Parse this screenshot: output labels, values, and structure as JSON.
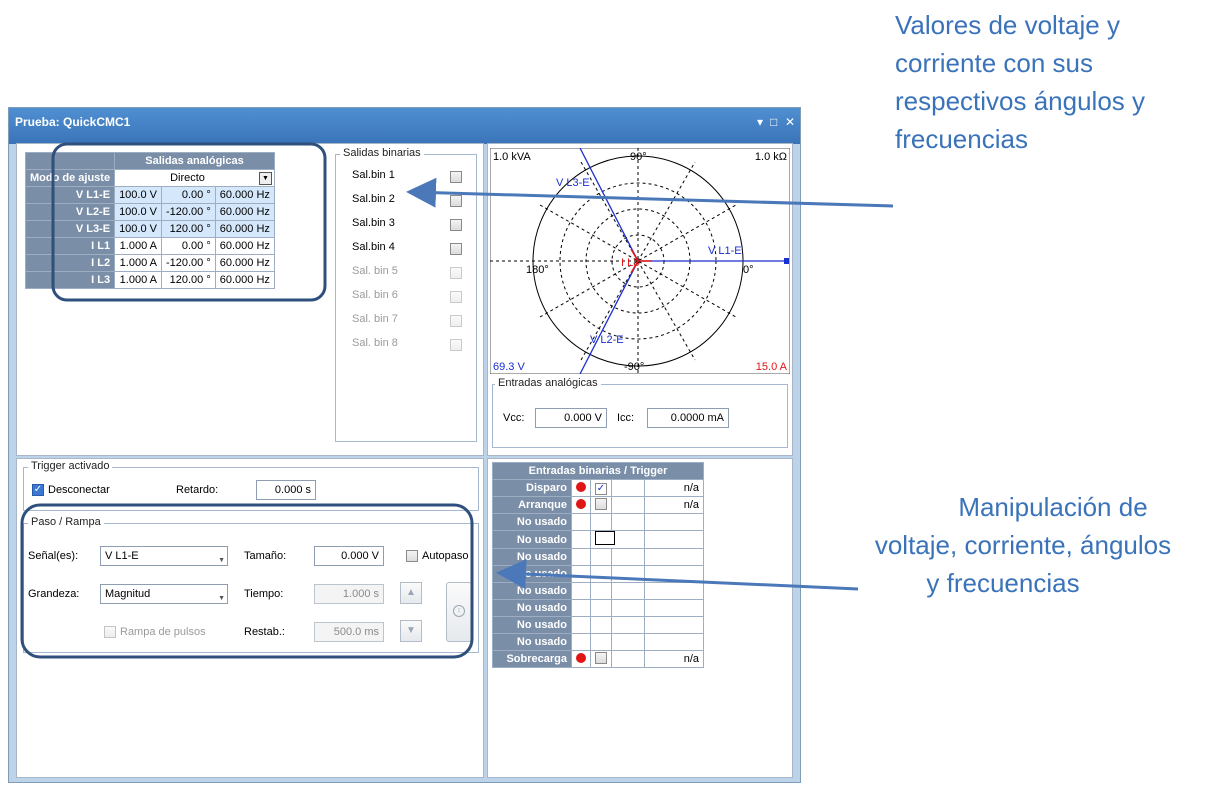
{
  "annotations": {
    "top_lines": [
      "Valores de voltaje y",
      "corriente con sus",
      "respectivos ángulos y",
      "frecuencias"
    ],
    "bottom_lines": [
      "Manipulación de",
      "voltaje, corriente, ángulos",
      "y frecuencias"
    ],
    "color": "#3a73b9"
  },
  "window": {
    "title": "Prueba: QuickCMC1",
    "controls": [
      "▾",
      "□",
      "✕"
    ]
  },
  "analog_outputs": {
    "header": "Salidas analógicas",
    "mode_label": "Modo de ajuste",
    "mode_value": "Directo",
    "rows": [
      {
        "name": "V L1-E",
        "mag": "100.0 V",
        "ang": "0.00 °",
        "freq": "60.000 Hz"
      },
      {
        "name": "V L2-E",
        "mag": "100.0 V",
        "ang": "-120.00 °",
        "freq": "60.000 Hz"
      },
      {
        "name": "V L3-E",
        "mag": "100.0 V",
        "ang": "120.00 °",
        "freq": "60.000 Hz"
      },
      {
        "name": "I L1",
        "mag": "1.000 A",
        "ang": "0.00 °",
        "freq": "60.000 Hz"
      },
      {
        "name": "I L2",
        "mag": "1.000 A",
        "ang": "-120.00 °",
        "freq": "60.000 Hz"
      },
      {
        "name": "I L3",
        "mag": "1.000 A",
        "ang": "120.00 °",
        "freq": "60.000 Hz"
      }
    ]
  },
  "binary_outputs": {
    "title": "Salidas binarias",
    "items": [
      "Sal.bin 1",
      "Sal.bin 2",
      "Sal.bin 3",
      "Sal.bin 4",
      "Sal. bin 5",
      "Sal. bin 6",
      "Sal. bin 7",
      "Sal. bin 8"
    ]
  },
  "vector": {
    "top_left": "1.0 kVA",
    "top_right": "1.0 kΩ",
    "bottom_left": "69.3  V",
    "bottom_right": "15.0  A",
    "ang_top": "90°",
    "ang_left": "180°",
    "ang_right": "0°",
    "ang_bottom": "-90°",
    "labels": {
      "v1": "V L1-E",
      "v2": "V L2-E",
      "v3": "V L3-E",
      "i": "I L3"
    }
  },
  "analog_inputs": {
    "title": "Entradas analógicas",
    "vcc_label": "Vcc:",
    "vcc_value": "0.000 V",
    "icc_label": "Icc:",
    "icc_value": "0.0000 mA"
  },
  "trigger": {
    "title": "Trigger activado",
    "disconnect_label": "Desconectar",
    "delay_label": "Retardo:",
    "delay_value": "0.000 s"
  },
  "step": {
    "title": "Paso / Rampa",
    "signal_label": "Señal(es):",
    "signal_value": "V L1-E",
    "size_label": "Tamaño:",
    "size_value": "0.000 V",
    "autostep_label": "Autopaso",
    "quantity_label": "Grandeza:",
    "quantity_value": "Magnitud",
    "time_label": "Tiempo:",
    "time_value": "1.000 s",
    "pulse_label": "Rampa de pulsos",
    "reset_label": "Restab.:",
    "reset_value": "500.0 ms"
  },
  "binary_inputs": {
    "header": "Entradas binarias / Trigger",
    "rows": [
      {
        "name": "Disparo",
        "dot": true,
        "checked": true,
        "val": "n/a"
      },
      {
        "name": "Arranque",
        "dot": true,
        "checked": false,
        "val": "n/a"
      },
      {
        "name": "No usado",
        "dot": false,
        "checked": false,
        "val": ""
      },
      {
        "name": "No usado",
        "dot": false,
        "checked": false,
        "val": ""
      },
      {
        "name": "No usado",
        "dot": false,
        "checked": false,
        "val": ""
      },
      {
        "name": "No usado",
        "dot": false,
        "checked": false,
        "val": ""
      },
      {
        "name": "No usado",
        "dot": false,
        "checked": false,
        "val": ""
      },
      {
        "name": "No usado",
        "dot": false,
        "checked": false,
        "val": ""
      },
      {
        "name": "No usado",
        "dot": false,
        "checked": false,
        "val": ""
      },
      {
        "name": "No usado",
        "dot": false,
        "checked": false,
        "val": ""
      },
      {
        "name": "Sobrecarga",
        "dot": true,
        "checked": false,
        "val": "n/a"
      }
    ]
  }
}
